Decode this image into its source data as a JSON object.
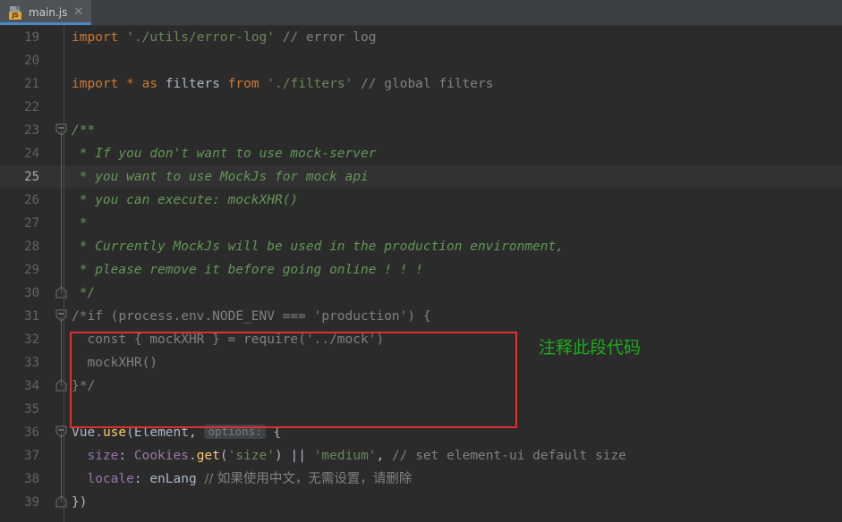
{
  "window": {
    "background_color": "#2b2b2b",
    "editor_background": "#2b2b2b",
    "current_line_background": "#323232"
  },
  "tabbar": {
    "background_color": "#3c3f41",
    "active_tab": {
      "title": "main.js",
      "icon": "js-file-icon",
      "icon_badge": "JS",
      "close_glyph": "✕",
      "active_underline_color": "#4a88c7",
      "background_color": "#4e5254"
    }
  },
  "editor": {
    "first_line_number": 19,
    "current_line_number": 25,
    "gutter_separator_color": "#4b4b4b",
    "lines": [
      {
        "number": "19",
        "fold": "none",
        "tokens": [
          {
            "t": "import",
            "c": "kw"
          },
          {
            "t": " ",
            "c": "id"
          },
          {
            "t": "'./utils/error-log'",
            "c": "str"
          },
          {
            "t": " ",
            "c": "id"
          },
          {
            "t": "// error log",
            "c": "cmt"
          }
        ]
      },
      {
        "number": "20",
        "fold": "none",
        "tokens": []
      },
      {
        "number": "21",
        "fold": "none",
        "tokens": [
          {
            "t": "import",
            "c": "kw"
          },
          {
            "t": " ",
            "c": "id"
          },
          {
            "t": "*",
            "c": "kw"
          },
          {
            "t": " ",
            "c": "id"
          },
          {
            "t": "as",
            "c": "kw"
          },
          {
            "t": " ",
            "c": "id"
          },
          {
            "t": "filters",
            "c": "id"
          },
          {
            "t": " ",
            "c": "id"
          },
          {
            "t": "from",
            "c": "kw"
          },
          {
            "t": " ",
            "c": "id"
          },
          {
            "t": "'./filters'",
            "c": "str"
          },
          {
            "t": " ",
            "c": "id"
          },
          {
            "t": "// global filters",
            "c": "cmt"
          }
        ]
      },
      {
        "number": "22",
        "fold": "none",
        "tokens": []
      },
      {
        "number": "23",
        "fold": "start",
        "tokens": [
          {
            "t": "/**",
            "c": "cmtg"
          }
        ]
      },
      {
        "number": "24",
        "fold": "line",
        "tokens": [
          {
            "t": " * If you don't want to use mock-server",
            "c": "cmtg"
          }
        ]
      },
      {
        "number": "25",
        "fold": "line",
        "tokens": [
          {
            "t": " * you want to use MockJs for mock api",
            "c": "cmtg"
          }
        ]
      },
      {
        "number": "26",
        "fold": "line",
        "tokens": [
          {
            "t": " * you can execute: mockXHR()",
            "c": "cmtg"
          }
        ]
      },
      {
        "number": "27",
        "fold": "line",
        "tokens": [
          {
            "t": " *",
            "c": "cmtg"
          }
        ]
      },
      {
        "number": "28",
        "fold": "line",
        "tokens": [
          {
            "t": " * Currently MockJs will be used in the production environment,",
            "c": "cmtg"
          }
        ]
      },
      {
        "number": "29",
        "fold": "line",
        "tokens": [
          {
            "t": " * please remove it before going online ! ! !",
            "c": "cmtg"
          }
        ]
      },
      {
        "number": "30",
        "fold": "end",
        "tokens": [
          {
            "t": " */",
            "c": "cmtg"
          }
        ]
      },
      {
        "number": "31",
        "fold": "start",
        "tokens": [
          {
            "t": "/*if (process.env.NODE_ENV === 'production') {",
            "c": "cmt"
          }
        ]
      },
      {
        "number": "32",
        "fold": "line",
        "tokens": [
          {
            "t": "  const { mockXHR } = require('../mock')",
            "c": "cmt"
          }
        ]
      },
      {
        "number": "33",
        "fold": "line",
        "tokens": [
          {
            "t": "  mockXHR()",
            "c": "cmt"
          }
        ]
      },
      {
        "number": "34",
        "fold": "end",
        "tokens": [
          {
            "t": "}*/",
            "c": "cmt"
          }
        ]
      },
      {
        "number": "35",
        "fold": "none",
        "tokens": []
      },
      {
        "number": "36",
        "fold": "start",
        "tokens": [
          {
            "t": "Vue",
            "c": "id"
          },
          {
            "t": ".",
            "c": "op"
          },
          {
            "t": "use",
            "c": "fn"
          },
          {
            "t": "(",
            "c": "op"
          },
          {
            "t": "Element",
            "c": "id"
          },
          {
            "t": ", ",
            "c": "op"
          },
          {
            "t": "options:",
            "c": "hint"
          },
          {
            "t": " {",
            "c": "op"
          }
        ]
      },
      {
        "number": "37",
        "fold": "line",
        "tokens": [
          {
            "t": "  ",
            "c": "id"
          },
          {
            "t": "size",
            "c": "prop"
          },
          {
            "t": ": ",
            "c": "op"
          },
          {
            "t": "Cookies",
            "c": "prop"
          },
          {
            "t": ".",
            "c": "op"
          },
          {
            "t": "get",
            "c": "fn"
          },
          {
            "t": "(",
            "c": "op"
          },
          {
            "t": "'size'",
            "c": "str"
          },
          {
            "t": ") ",
            "c": "op"
          },
          {
            "t": "||",
            "c": "op"
          },
          {
            "t": " ",
            "c": "op"
          },
          {
            "t": "'medium'",
            "c": "str"
          },
          {
            "t": ", ",
            "c": "op"
          },
          {
            "t": "// set element-ui default size",
            "c": "cmt"
          }
        ]
      },
      {
        "number": "38",
        "fold": "line",
        "tokens": [
          {
            "t": "  ",
            "c": "id"
          },
          {
            "t": "locale",
            "c": "prop"
          },
          {
            "t": ": ",
            "c": "op"
          },
          {
            "t": "enLang",
            "c": "id"
          },
          {
            "t": " ",
            "c": "op"
          },
          {
            "t": "// 如果使用中文，无需设置，请删除",
            "c": "cmt"
          }
        ]
      },
      {
        "number": "39",
        "fold": "end",
        "tokens": [
          {
            "t": "})",
            "c": "op"
          }
        ]
      }
    ]
  },
  "annotations": {
    "red_box": {
      "color": "#e03030",
      "covers_lines": "31-34"
    },
    "green_note": {
      "text": "注释此段代码",
      "color": "#1faa1f"
    }
  }
}
